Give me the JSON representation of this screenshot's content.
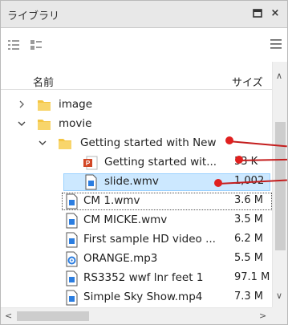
{
  "window": {
    "title": "ライブラリ",
    "pin_glyph": "ᄆ",
    "close_glyph": "×"
  },
  "header": {
    "name": "名前",
    "size": "サイズ"
  },
  "rows": [
    {
      "label": "image",
      "size": "",
      "type": "folder",
      "expanded": false
    },
    {
      "label": "movie",
      "size": "",
      "type": "folder",
      "expanded": true
    },
    {
      "label": "Getting started with New",
      "size": "",
      "type": "folder",
      "expanded": true
    },
    {
      "label": "Getting started wit...",
      "size": "53 K",
      "type": "ppt"
    },
    {
      "label": "slide.wmv",
      "size": "1,002",
      "type": "file"
    },
    {
      "label": "CM 1.wmv",
      "size": "3.6 M",
      "type": "file"
    },
    {
      "label": "CM MICKE.wmv",
      "size": "3.5 M",
      "type": "file"
    },
    {
      "label": "First sample HD video ...",
      "size": "6.2 M",
      "type": "file"
    },
    {
      "label": "ORANGE.mp3",
      "size": "5.5 M",
      "type": "audio"
    },
    {
      "label": "RS3352 wwf lnr feet 1",
      "size": "97.1 M",
      "type": "file"
    },
    {
      "label": "Simple Sky Show.mp4",
      "size": "7.3 M",
      "type": "file"
    }
  ],
  "colors": {
    "accent_selection": "#cce8ff",
    "callout": "#e0201f",
    "folder": "#f4c542"
  }
}
